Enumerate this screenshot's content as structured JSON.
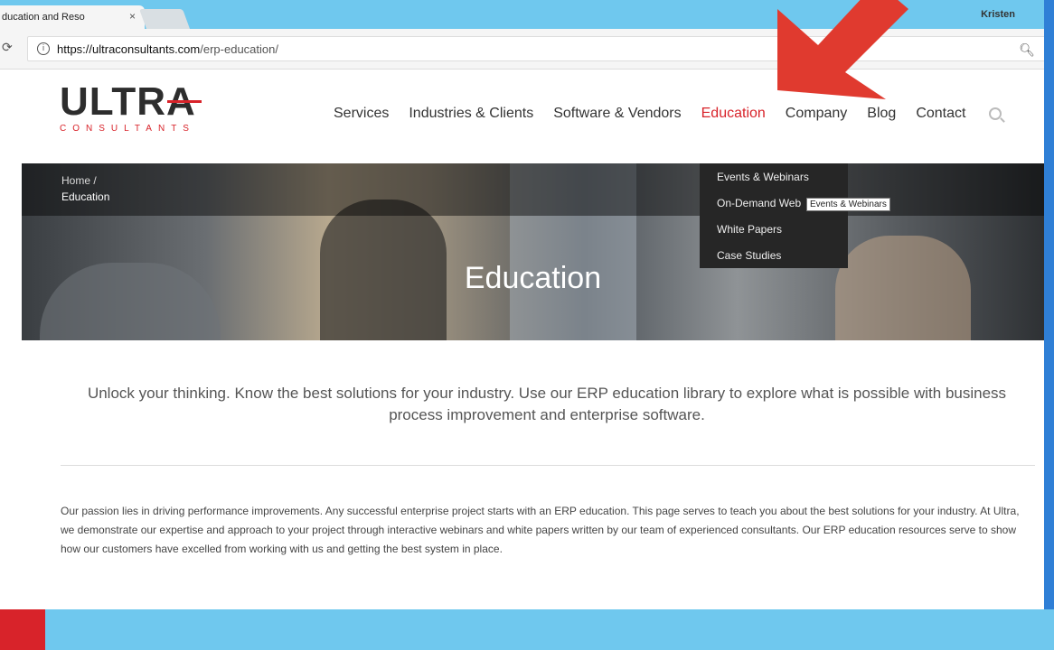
{
  "browser": {
    "tab_title": "ducation and Reso",
    "tab_close": "×",
    "user_name": "Kristen",
    "url_host": "https://ultraconsultants.com",
    "url_path": "/erp-education/"
  },
  "logo": {
    "main": "ULTRA",
    "sub": "CONSULTANTS"
  },
  "nav": {
    "items": [
      "Services",
      "Industries & Clients",
      "Software & Vendors",
      "Education",
      "Company",
      "Blog",
      "Contact"
    ],
    "active": "Education"
  },
  "hero": {
    "breadcrumb_home": "Home /",
    "breadcrumb_current": "Education",
    "title": "Education"
  },
  "dropdown": {
    "items": [
      "Events & Webinars",
      "On-Demand Web",
      "White Papers",
      "Case Studies"
    ],
    "tooltip": "Events & Webinars"
  },
  "content": {
    "intro": "Unlock your thinking. Know the best solutions for your industry. Use our ERP education library to explore what is possible with business process improvement and enterprise software.",
    "body": "Our passion lies in driving performance improvements. Any successful enterprise project starts with an ERP education. This page serves to teach you about the best solutions for your industry. At Ultra, we demonstrate our expertise and approach to your project through interactive webinars and white papers written by our team of experienced consultants. Our ERP education resources serve to show how our customers have excelled from working with us and getting the best system in place."
  },
  "colors": {
    "accent": "#d8232a",
    "arrow": "#e03a2f",
    "page_background": "#6fc8ee"
  },
  "icons": [
    "reload-icon",
    "info-icon",
    "zoom-icon",
    "search-icon",
    "close-icon"
  ]
}
